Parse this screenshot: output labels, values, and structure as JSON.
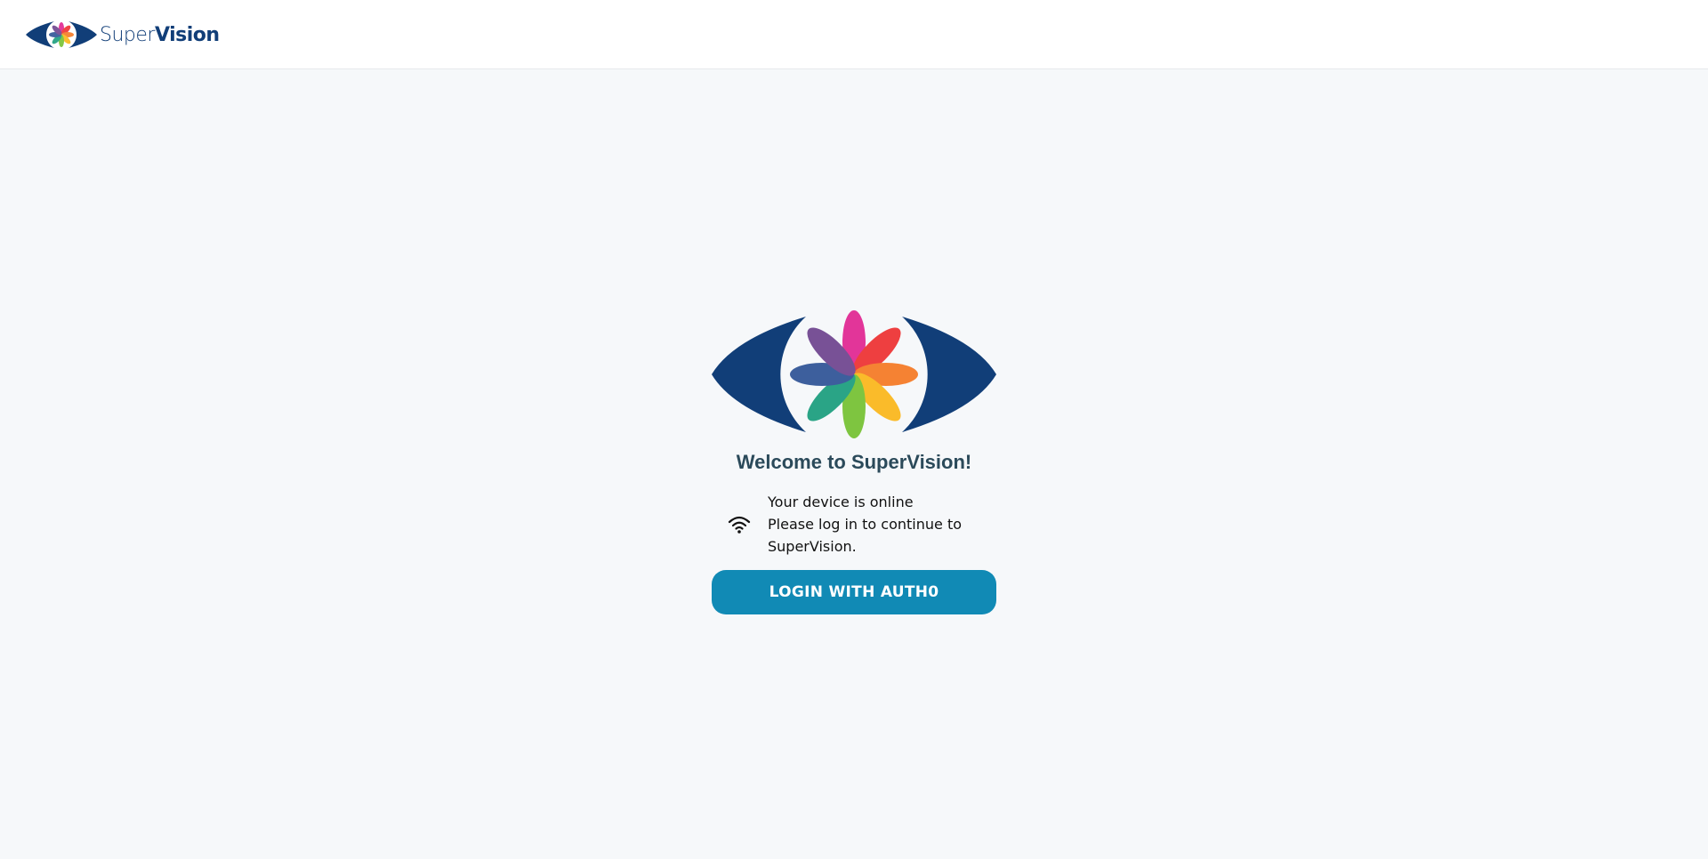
{
  "header": {
    "brand_light": "Super",
    "brand_bold": "Vision",
    "logo_icon": "supervision-eye-flower-logo"
  },
  "main": {
    "hero_icon": "supervision-eye-flower-logo",
    "welcome": "Welcome to SuperVision!",
    "status_icon": "wifi-icon",
    "status_line1": "Your device is online",
    "status_line2": "Please log in to continue to SuperVision.",
    "login_label": "LOGIN WITH AUTH0"
  },
  "colors": {
    "brand_navy": "#113e78",
    "button": "#118ab5",
    "background": "#f6f8fa",
    "heading": "#2b4a5a"
  }
}
